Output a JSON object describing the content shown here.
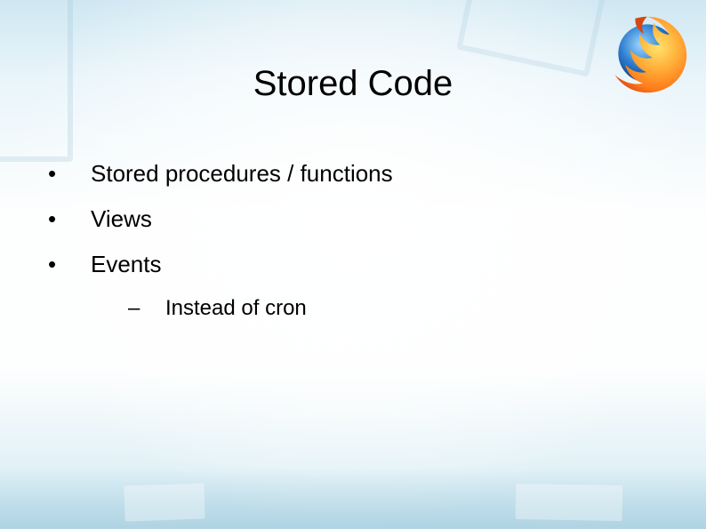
{
  "title": "Stored Code",
  "bullets": [
    {
      "text": "Stored procedures / functions",
      "sub": []
    },
    {
      "text": "Views",
      "sub": []
    },
    {
      "text": "Events",
      "sub": [
        {
          "text": "Instead of cron"
        }
      ]
    }
  ],
  "logo": {
    "name": "firefox"
  }
}
